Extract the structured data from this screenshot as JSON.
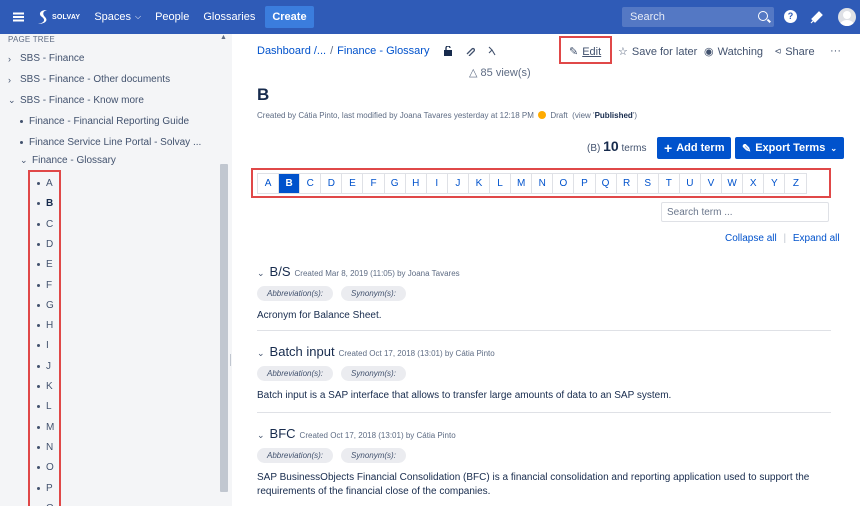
{
  "topbar": {
    "logo_text": "SOLVAY",
    "nav": [
      {
        "label": "Spaces",
        "caret": true
      },
      {
        "label": "People",
        "caret": false
      },
      {
        "label": "Glossaries",
        "caret": false
      }
    ],
    "create_label": "Create",
    "search_placeholder": "Search"
  },
  "sidebar": {
    "title": "PAGE TREE",
    "tree": [
      {
        "label": "SBS - Finance",
        "kind": "collapsed"
      },
      {
        "label": "SBS - Finance - Other documents",
        "kind": "collapsed"
      },
      {
        "label": "SBS - Finance - Know more",
        "kind": "expanded"
      },
      {
        "label": "Finance - Financial Reporting Guide",
        "kind": "bullet"
      },
      {
        "label": "Finance Service Line Portal - Solvay ...",
        "kind": "bullet"
      },
      {
        "label": "Finance - Glossary",
        "kind": "expanded"
      }
    ],
    "letters": [
      "A",
      "B",
      "C",
      "D",
      "E",
      "F",
      "G",
      "H",
      "I",
      "J",
      "K",
      "L",
      "M",
      "N",
      "O",
      "P",
      "Q"
    ],
    "active_letter": "B"
  },
  "page": {
    "breadcrumb": [
      "Dashboard /...",
      "/",
      "Finance - Glossary"
    ],
    "views": "85 view(s)",
    "toolbar": {
      "edit": "Edit",
      "save_for_later": "Save for later",
      "watching": "Watching",
      "share": "Share",
      "more": "···"
    },
    "title": "B",
    "byline_prefix": "Created by Cátia Pinto, last modified by Joana Tavares yesterday at 12:18 PM",
    "byline_draft": "Draft",
    "byline_view_open": "(view '",
    "byline_published": "Published",
    "byline_view_close": "')",
    "terms_prefix": "(B)",
    "terms_count": "10",
    "terms_suffix": "terms",
    "add_term": "Add term",
    "export_terms": "Export Terms",
    "alphabet": [
      "A",
      "B",
      "C",
      "D",
      "E",
      "F",
      "G",
      "H",
      "I",
      "J",
      "K",
      "L",
      "M",
      "N",
      "O",
      "P",
      "Q",
      "R",
      "S",
      "T",
      "U",
      "V",
      "W",
      "X",
      "Y",
      "Z"
    ],
    "active_letter": "B",
    "search_term_placeholder": "Search term ...",
    "collapse_all": "Collapse all",
    "expand_all": "Expand all",
    "entries": [
      {
        "term": "B/S",
        "meta": "Created Mar 8, 2019 (11:05) by Joana Tavares",
        "abbrev_label": "Abbreviation(s):",
        "synonym_label": "Synonym(s):",
        "description": "Acronym for Balance Sheet."
      },
      {
        "term": "Batch input",
        "meta": "Created Oct 17, 2018 (13:01) by Cátia Pinto",
        "abbrev_label": "Abbreviation(s):",
        "synonym_label": "Synonym(s):",
        "description": "Batch input is a SAP interface that allows to transfer large amounts of data to an SAP system."
      },
      {
        "term": "BFC",
        "meta": "Created Oct 17, 2018 (13:01) by Cátia Pinto",
        "abbrev_label": "Abbreviation(s):",
        "synonym_label": "Synonym(s):",
        "description": "SAP BusinessObjects Financial Consolidation (BFC) is a financial consolidation and reporting application used to support the requirements of the financial close of the companies."
      }
    ]
  },
  "colors": {
    "topbar": "#2f5bb7",
    "primary": "#0052cc",
    "highlight": "#e04848",
    "draft": "#ffab00"
  }
}
